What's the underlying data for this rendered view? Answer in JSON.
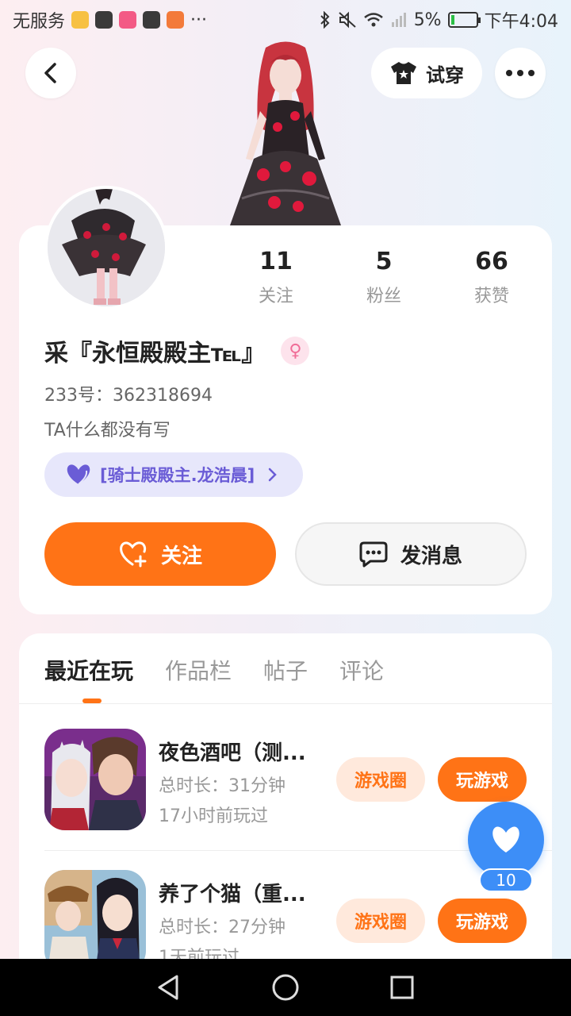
{
  "status_bar": {
    "carrier": "无服务",
    "more": "···",
    "battery": "5%",
    "time": "下午4:04"
  },
  "header": {
    "try_on_label": "试穿",
    "more_icon": "more-dots-icon",
    "back_icon": "back-arrow-icon"
  },
  "profile": {
    "stats": [
      {
        "value": "11",
        "label": "关注"
      },
      {
        "value": "5",
        "label": "粉丝"
      },
      {
        "value": "66",
        "label": "获赞"
      }
    ],
    "nickname": "采『永恒殿殿主℡』",
    "gender_symbol": "♀",
    "uid": "233号：362318694",
    "bio": "TA什么都没有写",
    "guard_label": "[骑士殿殿主.龙浩晨]",
    "follow_label": "关注",
    "message_label": "发消息"
  },
  "tabs": [
    {
      "label": "最近在玩"
    },
    {
      "label": "作品栏"
    },
    {
      "label": "帖子"
    },
    {
      "label": "评论"
    }
  ],
  "games": [
    {
      "title": "夜色酒吧（测...",
      "duration": "总时长：31分钟",
      "last_played": "17小时前玩过",
      "circle_label": "游戏圈",
      "play_label": "玩游戏"
    },
    {
      "title": "养了个猫（重...",
      "duration": "总时长：27分钟",
      "last_played": "1天前玩过",
      "circle_label": "游戏圈",
      "play_label": "玩游戏"
    }
  ],
  "fab": {
    "count": "10",
    "icon": "heart-icon"
  },
  "colors": {
    "accent": "#ff7316",
    "fab_blue": "#3d8ef7",
    "guard_purple": "#6a5cd6"
  }
}
